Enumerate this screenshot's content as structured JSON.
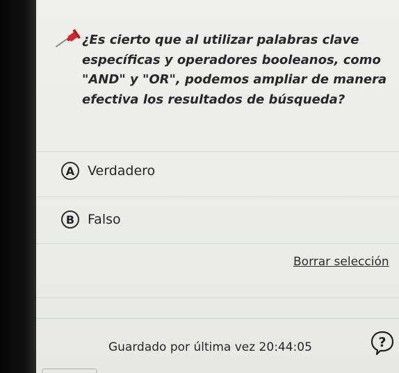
{
  "question": {
    "text": "¿Es cierto que al utilizar palabras clave específicas y operadores booleanos, como \"AND\" y \"OR\", podemos ampliar de manera efectiva los resultados de búsqueda?",
    "pin_icon": "pushpin-icon",
    "pin_color": "#d6262a"
  },
  "options": [
    {
      "letter": "A",
      "label": "Verdadero"
    },
    {
      "letter": "B",
      "label": "Falso"
    }
  ],
  "actions": {
    "clear_selection": "Borrar selección"
  },
  "footer": {
    "saved_text": "Guardado por última vez 20:44:05",
    "help_icon": "help-question-icon"
  }
}
